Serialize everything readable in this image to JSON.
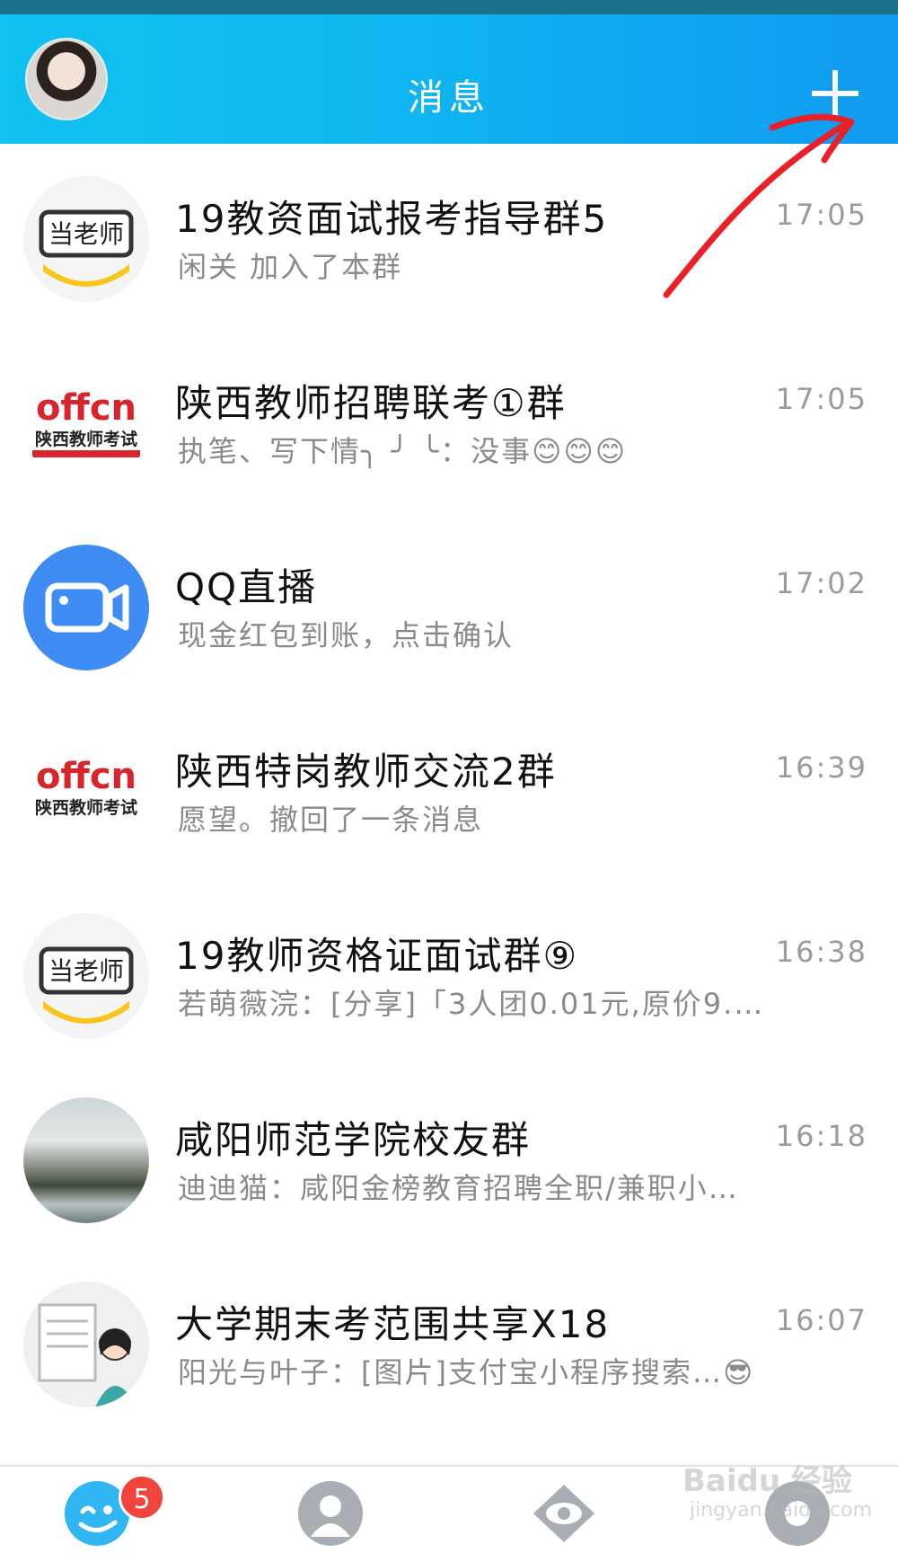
{
  "header": {
    "title": "消息"
  },
  "chats": [
    {
      "name": "19教资面试报考指导群5",
      "preview": "闲关 加入了本群",
      "time": "17:05",
      "avatar_icon": "dangaoshi-logo-icon"
    },
    {
      "name": "陕西教师招聘联考①群",
      "preview": "执笔、写下情╮ ╯ ╰：没事😊😊😊",
      "time": "17:05",
      "avatar_icon": "offcn-logo-icon"
    },
    {
      "name": "QQ直播",
      "preview": "现金红包到账，点击确认",
      "time": "17:02",
      "avatar_icon": "video-camera-icon"
    },
    {
      "name": "陕西特岗教师交流2群",
      "preview": "愿望。撤回了一条消息",
      "time": "16:39",
      "avatar_icon": "offcn-logo-icon"
    },
    {
      "name": "19教师资格证面试群⑨",
      "preview": "若萌薇浣：[分享]「3人团0.01元,原价9.…",
      "time": "16:38",
      "avatar_icon": "dangaoshi-logo-icon"
    },
    {
      "name": "咸阳师范学院校友群",
      "preview": "迪迪猫：咸阳金榜教育招聘全职/兼职小…",
      "time": "16:18",
      "avatar_icon": "landscape-photo-avatar"
    },
    {
      "name": "大学期末考范围共享X18",
      "preview": "阳光与叶子：[图片]支付宝小程序搜索…😎",
      "time": "16:07",
      "avatar_icon": "cartoon-drawing-avatar"
    }
  ],
  "avatar_text": {
    "dangaoshi": "当老师",
    "offcn": "offcn",
    "offcn_sub": "陕西教师考试"
  },
  "tabbar": {
    "messages_badge": "5"
  },
  "watermark": {
    "brand": "Baidu 经验",
    "url": "jingyan.baidu.com"
  },
  "colors": {
    "header_start": "#10c3f2",
    "header_end": "#109af0",
    "badge": "#f0443c",
    "annotation": "#e8202a"
  }
}
